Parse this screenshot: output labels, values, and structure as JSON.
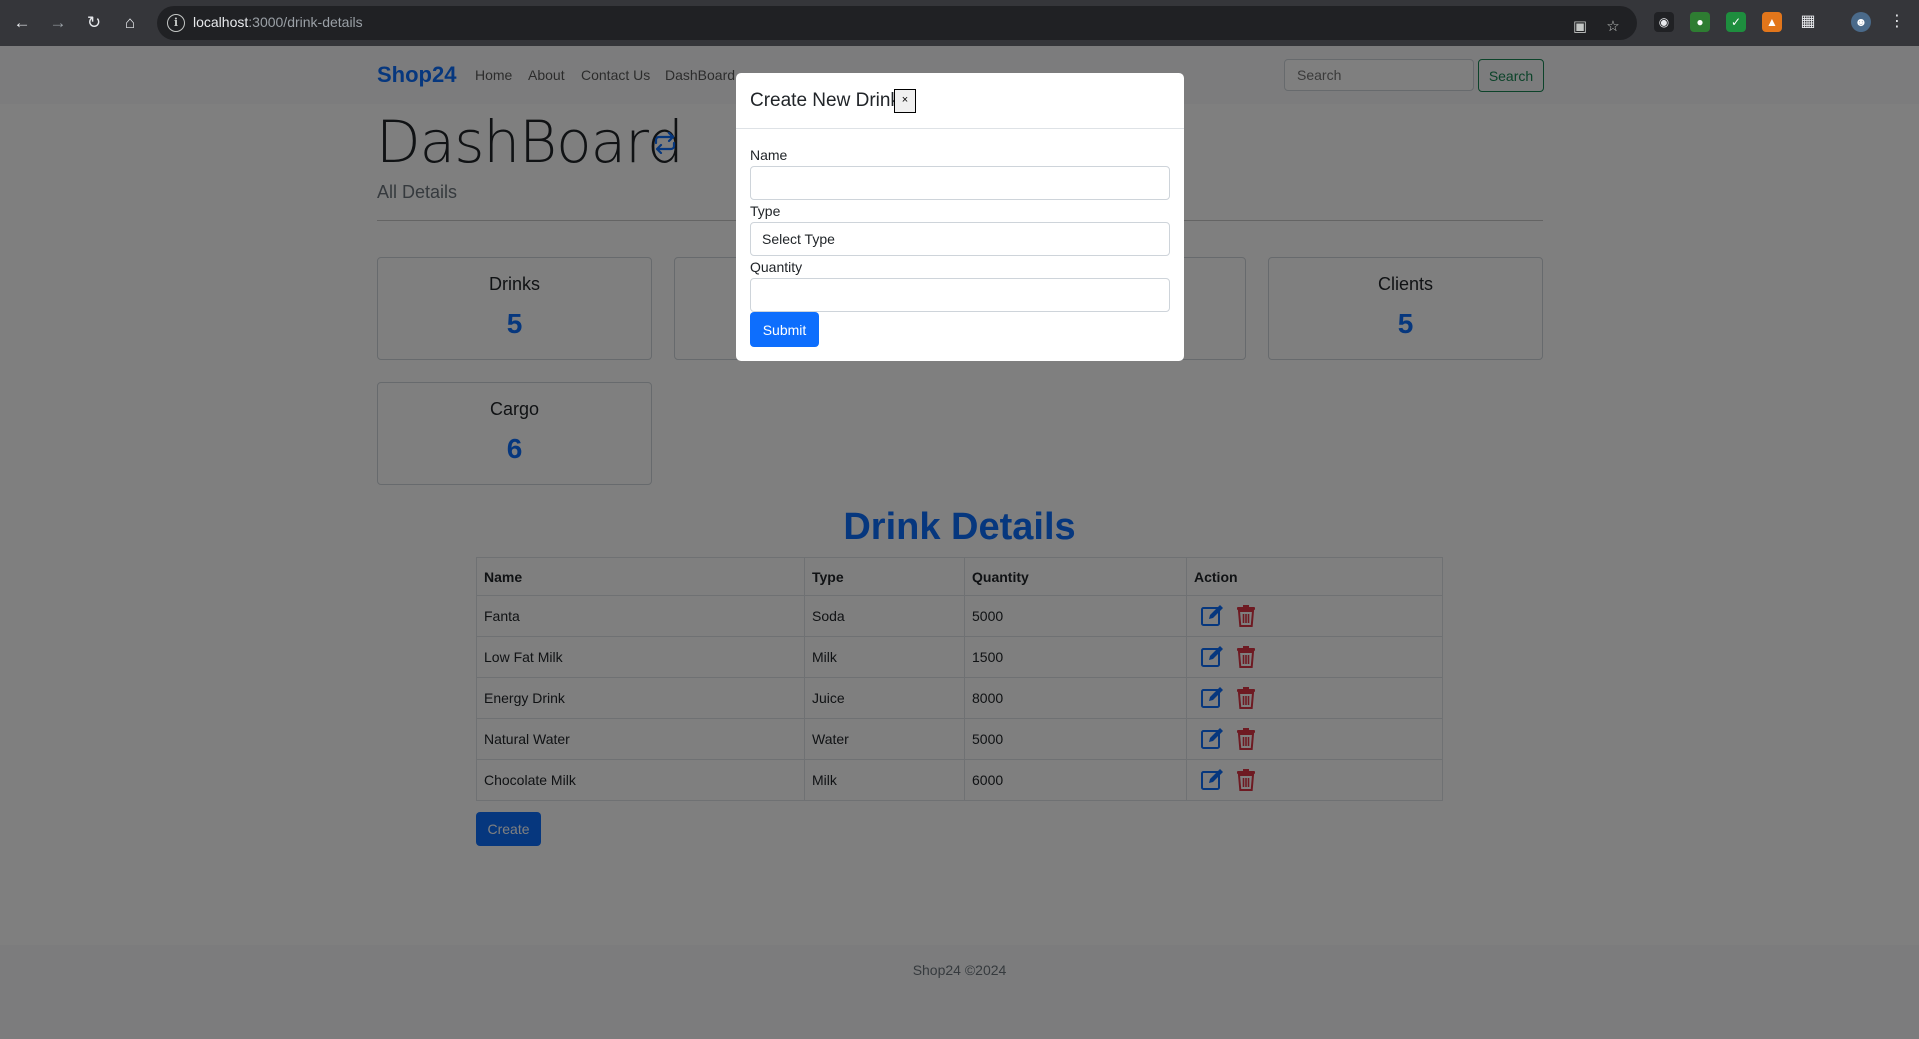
{
  "browser": {
    "url_host": "localhost",
    "url_path": ":3000/drink-details"
  },
  "navbar": {
    "brand": "Shop24",
    "links": [
      "Home",
      "About",
      "Contact Us",
      "DashBoard"
    ],
    "search_placeholder": "Search",
    "search_button": "Search"
  },
  "header": {
    "title": "DashBoard",
    "subtitle": "All Details"
  },
  "stats": [
    {
      "label": "Drinks",
      "value": "5"
    },
    {
      "label": "Clients",
      "value": "5"
    },
    {
      "label": "Cargo",
      "value": "6"
    }
  ],
  "section_title": "Drink Details",
  "table": {
    "headers": [
      "Name",
      "Type",
      "Quantity",
      "Action"
    ],
    "rows": [
      {
        "name": "Fanta",
        "type": "Soda",
        "quantity": "5000"
      },
      {
        "name": "Low Fat Milk",
        "type": "Milk",
        "quantity": "1500"
      },
      {
        "name": "Energy Drink",
        "type": "Juice",
        "quantity": "8000"
      },
      {
        "name": "Natural Water",
        "type": "Water",
        "quantity": "5000"
      },
      {
        "name": "Chocolate Milk",
        "type": "Milk",
        "quantity": "6000"
      }
    ]
  },
  "create_button": "Create",
  "footer": "Shop24 ©2024",
  "modal": {
    "title": "Create New Drink",
    "close": "×",
    "name_label": "Name",
    "name_value": "",
    "type_label": "Type",
    "type_value": "Select Type",
    "quantity_label": "Quantity",
    "quantity_value": "",
    "submit": "Submit"
  }
}
